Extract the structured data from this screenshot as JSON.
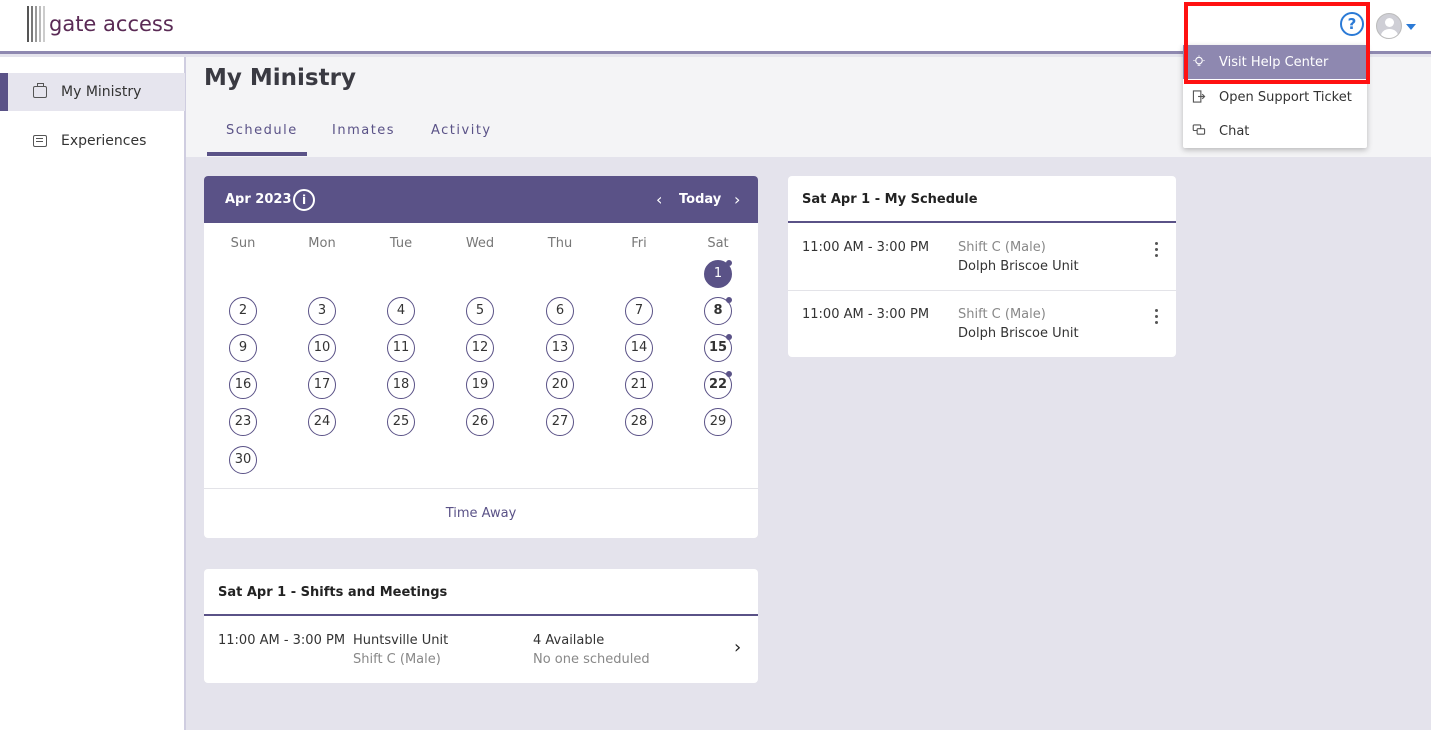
{
  "app": {
    "logo_text": "gate access"
  },
  "sidebar": {
    "items": [
      {
        "label": "My Ministry",
        "icon": "briefcase-icon"
      },
      {
        "label": "Experiences",
        "icon": "newspaper-icon"
      }
    ]
  },
  "page": {
    "title": "My Ministry",
    "tabs": [
      {
        "label": "Schedule"
      },
      {
        "label": "Inmates"
      },
      {
        "label": "Activity"
      }
    ]
  },
  "calendar": {
    "month": "Apr 2023",
    "today": "Today",
    "days_of_week": [
      "Sun",
      "Mon",
      "Tue",
      "Wed",
      "Thu",
      "Fri",
      "Sat"
    ],
    "days": [
      "1",
      "2",
      "3",
      "4",
      "5",
      "6",
      "7",
      "8",
      "9",
      "10",
      "11",
      "12",
      "13",
      "14",
      "15",
      "16",
      "17",
      "18",
      "19",
      "20",
      "21",
      "22",
      "23",
      "24",
      "25",
      "26",
      "27",
      "28",
      "29",
      "30"
    ],
    "selected_day": "1",
    "time_away": "Time Away"
  },
  "my_schedule": {
    "title": "Sat Apr 1 - My Schedule",
    "rows": [
      {
        "time": "11:00 AM - 3:00 PM",
        "shift": "Shift C (Male)",
        "unit": "Dolph Briscoe Unit"
      },
      {
        "time": "11:00 AM - 3:00 PM",
        "shift": "Shift C (Male)",
        "unit": "Dolph Briscoe Unit"
      }
    ]
  },
  "shifts_meetings": {
    "title": "Sat Apr 1 - Shifts and Meetings",
    "rows": [
      {
        "time": "11:00 AM - 3:00 PM",
        "unit": "Huntsville Unit",
        "shift": "Shift C (Male)",
        "available": "4 Available",
        "scheduled": "No one scheduled"
      }
    ]
  },
  "help_menu": {
    "items": [
      {
        "label": "Visit Help Center",
        "icon": "lightbulb-icon"
      },
      {
        "label": "Open Support Ticket",
        "icon": "ticket-icon"
      },
      {
        "label": "Chat",
        "icon": "chat-icon"
      }
    ]
  },
  "colors": {
    "brand": "#5a5287",
    "help_blue": "#2b7ad6",
    "highlight": "#ff1111"
  }
}
